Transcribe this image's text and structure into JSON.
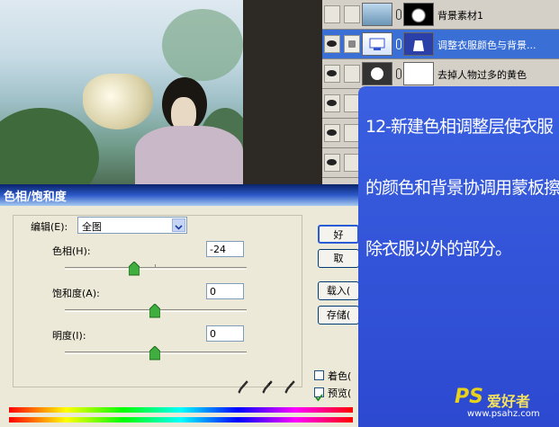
{
  "layers": [
    {
      "name": "背景素材1",
      "visible": false,
      "selected": false
    },
    {
      "name": "调整衣服颜色与背景...",
      "visible": true,
      "selected": true
    },
    {
      "name": "去掉人物过多的黄色",
      "visible": true,
      "selected": false
    }
  ],
  "dialog": {
    "title": "色相/饱和度",
    "edit_label": "编辑(E):",
    "edit_value": "全图",
    "hue_label": "色相(H):",
    "hue_value": "-24",
    "saturation_label": "饱和度(A):",
    "saturation_value": "0",
    "lightness_label": "明度(I):",
    "lightness_value": "0",
    "ok_label": "好",
    "cancel_label": "取",
    "load_label": "载入(",
    "save_label": "存储(",
    "colorize_label": "着色(",
    "preview_label": "预览(",
    "colorize_checked": false,
    "preview_checked": true
  },
  "note": {
    "lines": [
      "12-新建色相调整层使衣服",
      "的颜色和背景协调用蒙板擦",
      "除衣服以外的部分。"
    ],
    "color": "#2f4fd8"
  },
  "watermark": {
    "brand_ps": "PS",
    "brand_cn": "爱好者",
    "url": "www.psahz.com"
  }
}
